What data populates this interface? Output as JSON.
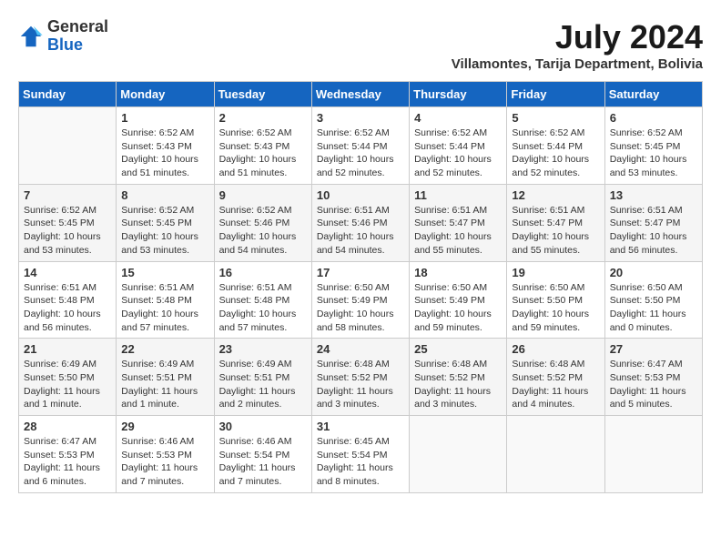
{
  "header": {
    "logo_general": "General",
    "logo_blue": "Blue",
    "month_title": "July 2024",
    "subtitle": "Villamontes, Tarija Department, Bolivia"
  },
  "calendar": {
    "days_of_week": [
      "Sunday",
      "Monday",
      "Tuesday",
      "Wednesday",
      "Thursday",
      "Friday",
      "Saturday"
    ],
    "weeks": [
      [
        {
          "day": "",
          "info": ""
        },
        {
          "day": "1",
          "info": "Sunrise: 6:52 AM\nSunset: 5:43 PM\nDaylight: 10 hours\nand 51 minutes."
        },
        {
          "day": "2",
          "info": "Sunrise: 6:52 AM\nSunset: 5:43 PM\nDaylight: 10 hours\nand 51 minutes."
        },
        {
          "day": "3",
          "info": "Sunrise: 6:52 AM\nSunset: 5:44 PM\nDaylight: 10 hours\nand 52 minutes."
        },
        {
          "day": "4",
          "info": "Sunrise: 6:52 AM\nSunset: 5:44 PM\nDaylight: 10 hours\nand 52 minutes."
        },
        {
          "day": "5",
          "info": "Sunrise: 6:52 AM\nSunset: 5:44 PM\nDaylight: 10 hours\nand 52 minutes."
        },
        {
          "day": "6",
          "info": "Sunrise: 6:52 AM\nSunset: 5:45 PM\nDaylight: 10 hours\nand 53 minutes."
        }
      ],
      [
        {
          "day": "7",
          "info": "Sunrise: 6:52 AM\nSunset: 5:45 PM\nDaylight: 10 hours\nand 53 minutes."
        },
        {
          "day": "8",
          "info": "Sunrise: 6:52 AM\nSunset: 5:45 PM\nDaylight: 10 hours\nand 53 minutes."
        },
        {
          "day": "9",
          "info": "Sunrise: 6:52 AM\nSunset: 5:46 PM\nDaylight: 10 hours\nand 54 minutes."
        },
        {
          "day": "10",
          "info": "Sunrise: 6:51 AM\nSunset: 5:46 PM\nDaylight: 10 hours\nand 54 minutes."
        },
        {
          "day": "11",
          "info": "Sunrise: 6:51 AM\nSunset: 5:47 PM\nDaylight: 10 hours\nand 55 minutes."
        },
        {
          "day": "12",
          "info": "Sunrise: 6:51 AM\nSunset: 5:47 PM\nDaylight: 10 hours\nand 55 minutes."
        },
        {
          "day": "13",
          "info": "Sunrise: 6:51 AM\nSunset: 5:47 PM\nDaylight: 10 hours\nand 56 minutes."
        }
      ],
      [
        {
          "day": "14",
          "info": "Sunrise: 6:51 AM\nSunset: 5:48 PM\nDaylight: 10 hours\nand 56 minutes."
        },
        {
          "day": "15",
          "info": "Sunrise: 6:51 AM\nSunset: 5:48 PM\nDaylight: 10 hours\nand 57 minutes."
        },
        {
          "day": "16",
          "info": "Sunrise: 6:51 AM\nSunset: 5:48 PM\nDaylight: 10 hours\nand 57 minutes."
        },
        {
          "day": "17",
          "info": "Sunrise: 6:50 AM\nSunset: 5:49 PM\nDaylight: 10 hours\nand 58 minutes."
        },
        {
          "day": "18",
          "info": "Sunrise: 6:50 AM\nSunset: 5:49 PM\nDaylight: 10 hours\nand 59 minutes."
        },
        {
          "day": "19",
          "info": "Sunrise: 6:50 AM\nSunset: 5:50 PM\nDaylight: 10 hours\nand 59 minutes."
        },
        {
          "day": "20",
          "info": "Sunrise: 6:50 AM\nSunset: 5:50 PM\nDaylight: 11 hours\nand 0 minutes."
        }
      ],
      [
        {
          "day": "21",
          "info": "Sunrise: 6:49 AM\nSunset: 5:50 PM\nDaylight: 11 hours\nand 1 minute."
        },
        {
          "day": "22",
          "info": "Sunrise: 6:49 AM\nSunset: 5:51 PM\nDaylight: 11 hours\nand 1 minute."
        },
        {
          "day": "23",
          "info": "Sunrise: 6:49 AM\nSunset: 5:51 PM\nDaylight: 11 hours\nand 2 minutes."
        },
        {
          "day": "24",
          "info": "Sunrise: 6:48 AM\nSunset: 5:52 PM\nDaylight: 11 hours\nand 3 minutes."
        },
        {
          "day": "25",
          "info": "Sunrise: 6:48 AM\nSunset: 5:52 PM\nDaylight: 11 hours\nand 3 minutes."
        },
        {
          "day": "26",
          "info": "Sunrise: 6:48 AM\nSunset: 5:52 PM\nDaylight: 11 hours\nand 4 minutes."
        },
        {
          "day": "27",
          "info": "Sunrise: 6:47 AM\nSunset: 5:53 PM\nDaylight: 11 hours\nand 5 minutes."
        }
      ],
      [
        {
          "day": "28",
          "info": "Sunrise: 6:47 AM\nSunset: 5:53 PM\nDaylight: 11 hours\nand 6 minutes."
        },
        {
          "day": "29",
          "info": "Sunrise: 6:46 AM\nSunset: 5:53 PM\nDaylight: 11 hours\nand 7 minutes."
        },
        {
          "day": "30",
          "info": "Sunrise: 6:46 AM\nSunset: 5:54 PM\nDaylight: 11 hours\nand 7 minutes."
        },
        {
          "day": "31",
          "info": "Sunrise: 6:45 AM\nSunset: 5:54 PM\nDaylight: 11 hours\nand 8 minutes."
        },
        {
          "day": "",
          "info": ""
        },
        {
          "day": "",
          "info": ""
        },
        {
          "day": "",
          "info": ""
        }
      ]
    ]
  }
}
